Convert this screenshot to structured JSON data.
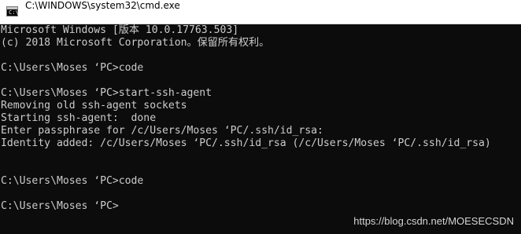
{
  "window": {
    "title": "C:\\WINDOWS\\system32\\cmd.exe",
    "icon": "cmd-icon",
    "icon_glyph": "C:\\"
  },
  "console": {
    "lines": [
      "Microsoft Windows [版本 10.0.17763.503]",
      "(c) 2018 Microsoft Corporation。保留所有权利。",
      "",
      "C:\\Users\\Moses ‘PC>code",
      "",
      "C:\\Users\\Moses ‘PC>start-ssh-agent",
      "Removing old ssh-agent sockets",
      "Starting ssh-agent:  done",
      "Enter passphrase for /c/Users/Moses ‘PC/.ssh/id_rsa:",
      "Identity added: /c/Users/Moses ‘PC/.ssh/id_rsa (/c/Users/Moses ‘PC/.ssh/id_rsa)",
      "",
      "",
      "C:\\Users\\Moses ‘PC>code",
      "",
      "C:\\Users\\Moses ‘PC>"
    ],
    "background_color": "#0c0c0c",
    "text_color": "#cccccc"
  },
  "watermark": {
    "text": "https://blog.csdn.net/MOESECSDN"
  }
}
